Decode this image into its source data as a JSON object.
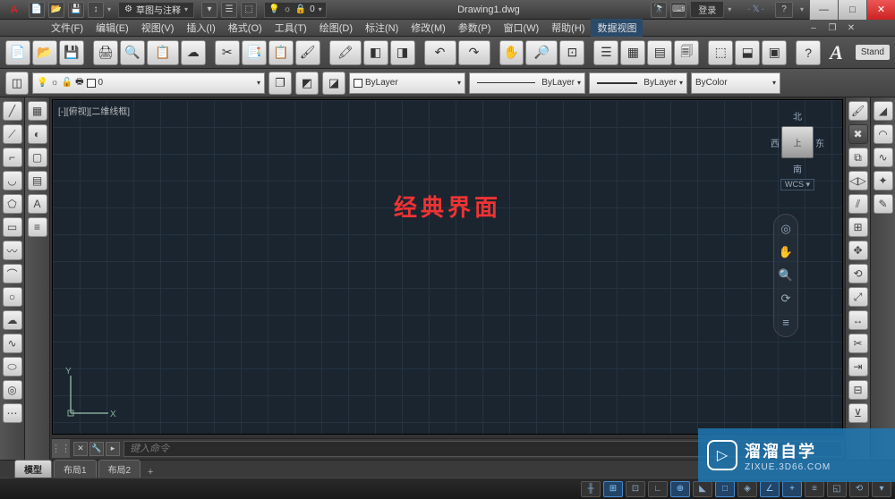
{
  "title": "Drawing1.dwg",
  "workspace": "草图与注释",
  "login_label": "登录",
  "exchange_label": "·𝕏·",
  "menus": [
    "文件(F)",
    "编辑(E)",
    "视图(V)",
    "插入(I)",
    "格式(O)",
    "工具(T)",
    "绘图(D)",
    "标注(N)",
    "修改(M)",
    "参数(P)",
    "窗口(W)",
    "帮助(H)",
    "数据视图"
  ],
  "active_menu_index": 12,
  "stand_label": "Stand",
  "layer_combo": {
    "lock": "🔓",
    "value": "0"
  },
  "prop1": "ByLayer",
  "prop2": "ByLayer",
  "prop3": "ByLayer",
  "prop4": "ByColor",
  "viewport_label": "[-][俯视][二维线框]",
  "center_text": "经典界面",
  "viewcube": {
    "n": "北",
    "s": "南",
    "e": "东",
    "w": "西",
    "face": "上",
    "wcs": "WCS ▾"
  },
  "cmd_placeholder": "键入命令",
  "tabs": [
    "模型",
    "布局1",
    "布局2"
  ],
  "active_tab_index": 0,
  "ucs": {
    "x": "X",
    "y": "Y"
  },
  "watermark": {
    "brand": "溜溜自学",
    "url": "ZIXUE.3D66.COM"
  },
  "icons": {
    "new": "📄",
    "open": "📂",
    "save": "💾",
    "arrow": "↕",
    "gear": "⚙",
    "bulb": "💡",
    "lock": "🔒",
    "zero": "0",
    "undo": "↶",
    "redo": "↷",
    "print": "🖨",
    "plot": "📋",
    "find": "🔍",
    "cut": "✂",
    "copy": "📑",
    "paste": "📋",
    "match": "🖌",
    "brush": "🖍",
    "block": "◧",
    "layer": "◨",
    "pan": "✋",
    "zoom": "🔎",
    "zoomw": "⊡",
    "props": "☰",
    "sheet": "▦",
    "tool": "▤",
    "calc": "🗐",
    "design": "⬚",
    "ref": "⬓",
    "help": "?",
    "layermgr": "◫",
    "layers": "❐",
    "layerp": "◩",
    "layern": "◪",
    "line": "╱",
    "cline": "⟋",
    "pline": "⌐",
    "arc": "◡",
    "poly": "⬠",
    "rect": "▭",
    "circle": "○",
    "ellipse": "⬭",
    "rev": "☁",
    "spline": "∿",
    "donut": "◎",
    "cloud2": "☁",
    "point": "⋯",
    "hatch": "▦",
    "region": "▢",
    "table": "▤",
    "text": "A",
    "move": "✥",
    "rot": "⟲",
    "trim": "✂",
    "mirror": "◁▷",
    "extend": "⇥",
    "stretch": "↔",
    "scale": "⤢",
    "fillet": "◠",
    "array": "⋮⋮",
    "offset": "⫽",
    "erase": "✕",
    "explode": "✦",
    "join": "⊻",
    "chamfer": "◢",
    "break": "⊟",
    "edit": "✎"
  }
}
